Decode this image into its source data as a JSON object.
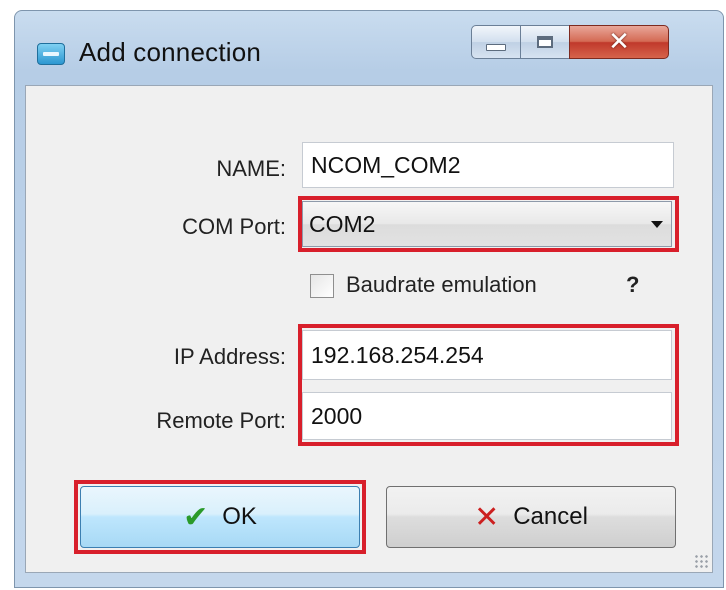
{
  "window": {
    "title": "Add connection",
    "close_glyph": "✕"
  },
  "form": {
    "name_label": "NAME:",
    "name_value": "NCOM_COM2",
    "com_port_label": "COM Port:",
    "com_port_value": "COM2",
    "baudrate_label": "Baudrate emulation",
    "baudrate_checked": false,
    "help_label": "?",
    "ip_label": "IP Address:",
    "ip_value": "192.168.254.254",
    "remote_port_label": "Remote Port:",
    "remote_port_value": "2000"
  },
  "buttons": {
    "ok_label": "OK",
    "ok_icon": "check-icon",
    "cancel_label": "Cancel",
    "cancel_icon": "x-icon"
  },
  "highlight_color": "#d81f2b"
}
